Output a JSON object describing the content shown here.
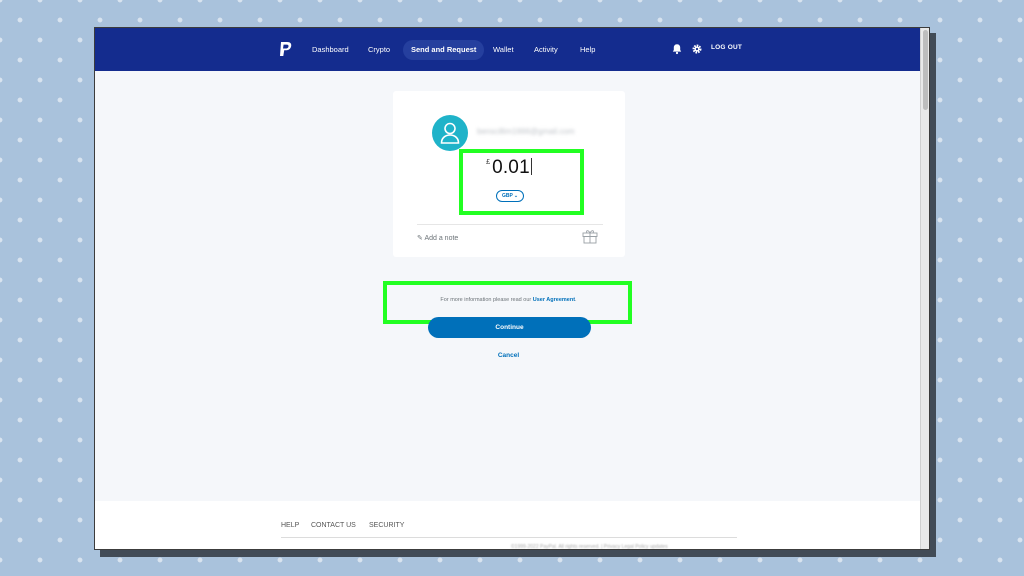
{
  "nav": {
    "items": [
      {
        "label": "Dashboard"
      },
      {
        "label": "Crypto"
      },
      {
        "label": "Send and Request"
      },
      {
        "label": "Wallet"
      },
      {
        "label": "Activity"
      },
      {
        "label": "Help"
      }
    ],
    "active": "Send and Request",
    "logout_label": "LOG OUT",
    "bar_color": "#142c8e"
  },
  "recipient": {
    "email": "benscillim1666@gmail.com"
  },
  "payment": {
    "currency_symbol": "£",
    "amount": "0.01",
    "currency_code": "GBP",
    "note_label": "Add a note"
  },
  "agreement": {
    "text": "For more information please read our ",
    "link": "User Agreement",
    "end": "."
  },
  "actions": {
    "continue_label": "Continue",
    "cancel_label": "Cancel",
    "accent_color": "#0070ba",
    "highlight_color": "#22ff22"
  },
  "footer": {
    "links": [
      {
        "label": "HELP"
      },
      {
        "label": "CONTACT US"
      },
      {
        "label": "SECURITY"
      }
    ],
    "fine_print": "©1999-2022 PayPal. All rights reserved.  |  Privacy  Legal  Policy updates"
  }
}
